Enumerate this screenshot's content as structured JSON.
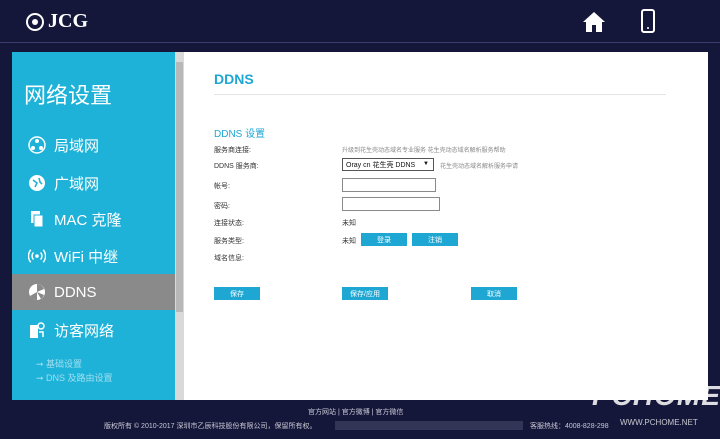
{
  "header": {
    "brand": "JCG",
    "home_icon": "home-icon",
    "phone_icon": "phone-icon"
  },
  "sidebar": {
    "title": "网络设置",
    "items": [
      {
        "label": "局域网",
        "icon": "lan-icon",
        "active": false
      },
      {
        "label": "广域网",
        "icon": "wan-icon",
        "active": false
      },
      {
        "label": "MAC 克隆",
        "icon": "mac-clone-icon",
        "active": false
      },
      {
        "label": "WiFi 中继",
        "icon": "wifi-relay-icon",
        "active": false
      },
      {
        "label": "DDNS",
        "icon": "ddns-icon",
        "active": true
      },
      {
        "label": "访客网络",
        "icon": "guest-network-icon",
        "active": false
      }
    ],
    "subitems": [
      "基础设置",
      "DNS 及路由设置"
    ]
  },
  "main": {
    "title": "DDNS",
    "section": "DDNS 设置",
    "rows": {
      "provider_link_label": "服务商连接:",
      "provider_link_value": "升级到花生壳动态域名专业服务 花生壳动态域名解析服务帮助",
      "provider_label": "DDNS 服务商:",
      "provider_selected": "Oray cn 花生壳 DDNS",
      "provider_hint": "花生壳动态域名解析服务申请",
      "account_label": "帐号:",
      "account_value": "",
      "password_label": "密码:",
      "password_value": "",
      "status_label": "连接状态:",
      "status_value": "未知",
      "service_type_label": "服务类型:",
      "service_type_value": "未知",
      "login_button": "登录",
      "logout_button": "注销",
      "domain_info_label": "域名信息:"
    },
    "buttons": {
      "save": "保存",
      "save_apply": "保存/应用",
      "cancel": "取消"
    }
  },
  "footer": {
    "links": "官方网站 | 官方微博 | 官方微信",
    "copyright": "版权所有 © 2010-2017 深圳市乙辰科技股份有限公司，保留所有权。",
    "hotline": "客服热线：4008-828-298"
  },
  "watermark": {
    "brand": "PCHOME",
    "url": "WWW.PCHOME.NET"
  }
}
